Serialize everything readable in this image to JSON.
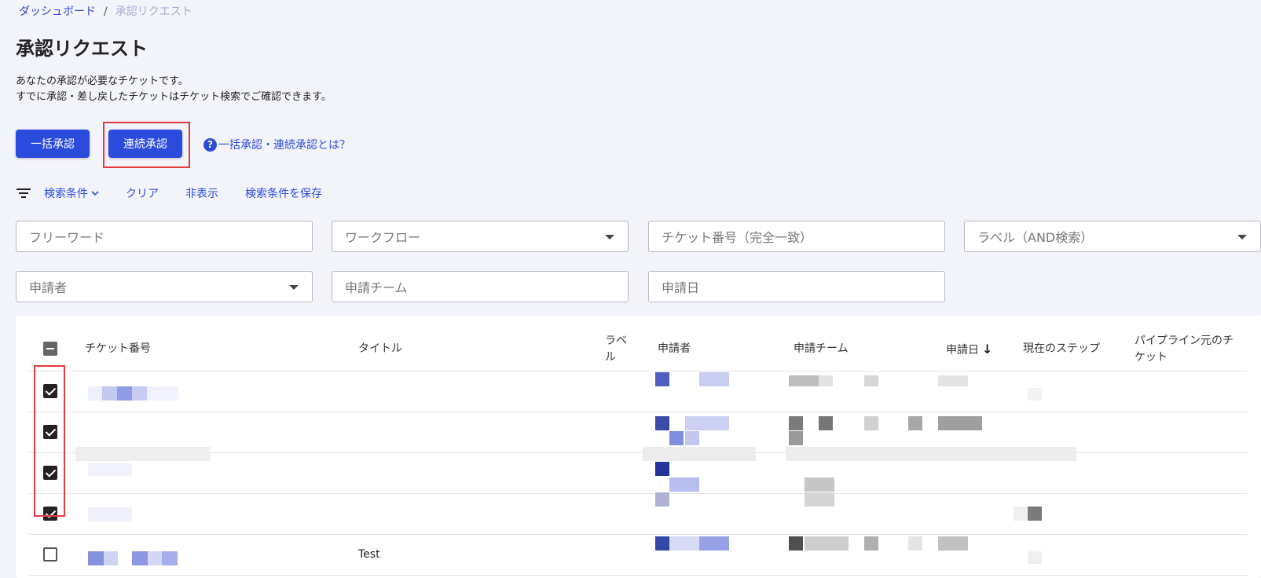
{
  "breadcrumb": {
    "home": "ダッシュボード",
    "separator": "/",
    "current": "承認リクエスト"
  },
  "page": {
    "title": "承認リクエスト",
    "description_line1": "あなたの承認が必要なチケットです。",
    "description_line2": "すでに承認・差し戻したチケットはチケット検索でご確認できます。"
  },
  "actions": {
    "bulk_approve": "一括承認",
    "sequential_approve": "連続承認",
    "help_icon": "?",
    "help_link": "一括承認・連続承認とは？"
  },
  "filters": {
    "icon": "filter-list-icon",
    "search_conditions": "検索条件",
    "clear": "クリア",
    "hide": "非表示",
    "save": "検索条件を保存"
  },
  "fields": {
    "freeword": "フリーワード",
    "workflow": "ワークフロー",
    "ticket_number": "チケット番号（完全一致）",
    "label": "ラベル（AND検索）",
    "applicant": "申請者",
    "applicant_team": "申請チーム",
    "applied_date": "申請日"
  },
  "table": {
    "headers": {
      "ticket_number": "チケット番号",
      "title": "タイトル",
      "label_line1": "ラベ",
      "label_line2": "ル",
      "applicant": "申請者",
      "team": "申請チーム",
      "date": "申請日",
      "date_sort": "↓",
      "current_step": "現在のステップ",
      "pipeline_line1": "パイプライン元のチ",
      "pipeline_line2": "ケット"
    },
    "rows": [
      {
        "checked": true,
        "title": ""
      },
      {
        "checked": true,
        "title": ""
      },
      {
        "checked": true,
        "title": ""
      },
      {
        "checked": true,
        "title": ""
      },
      {
        "checked": false,
        "title": "Test"
      }
    ]
  },
  "colors": {
    "accent": "#2b4bdc",
    "highlight": "#e53940"
  }
}
